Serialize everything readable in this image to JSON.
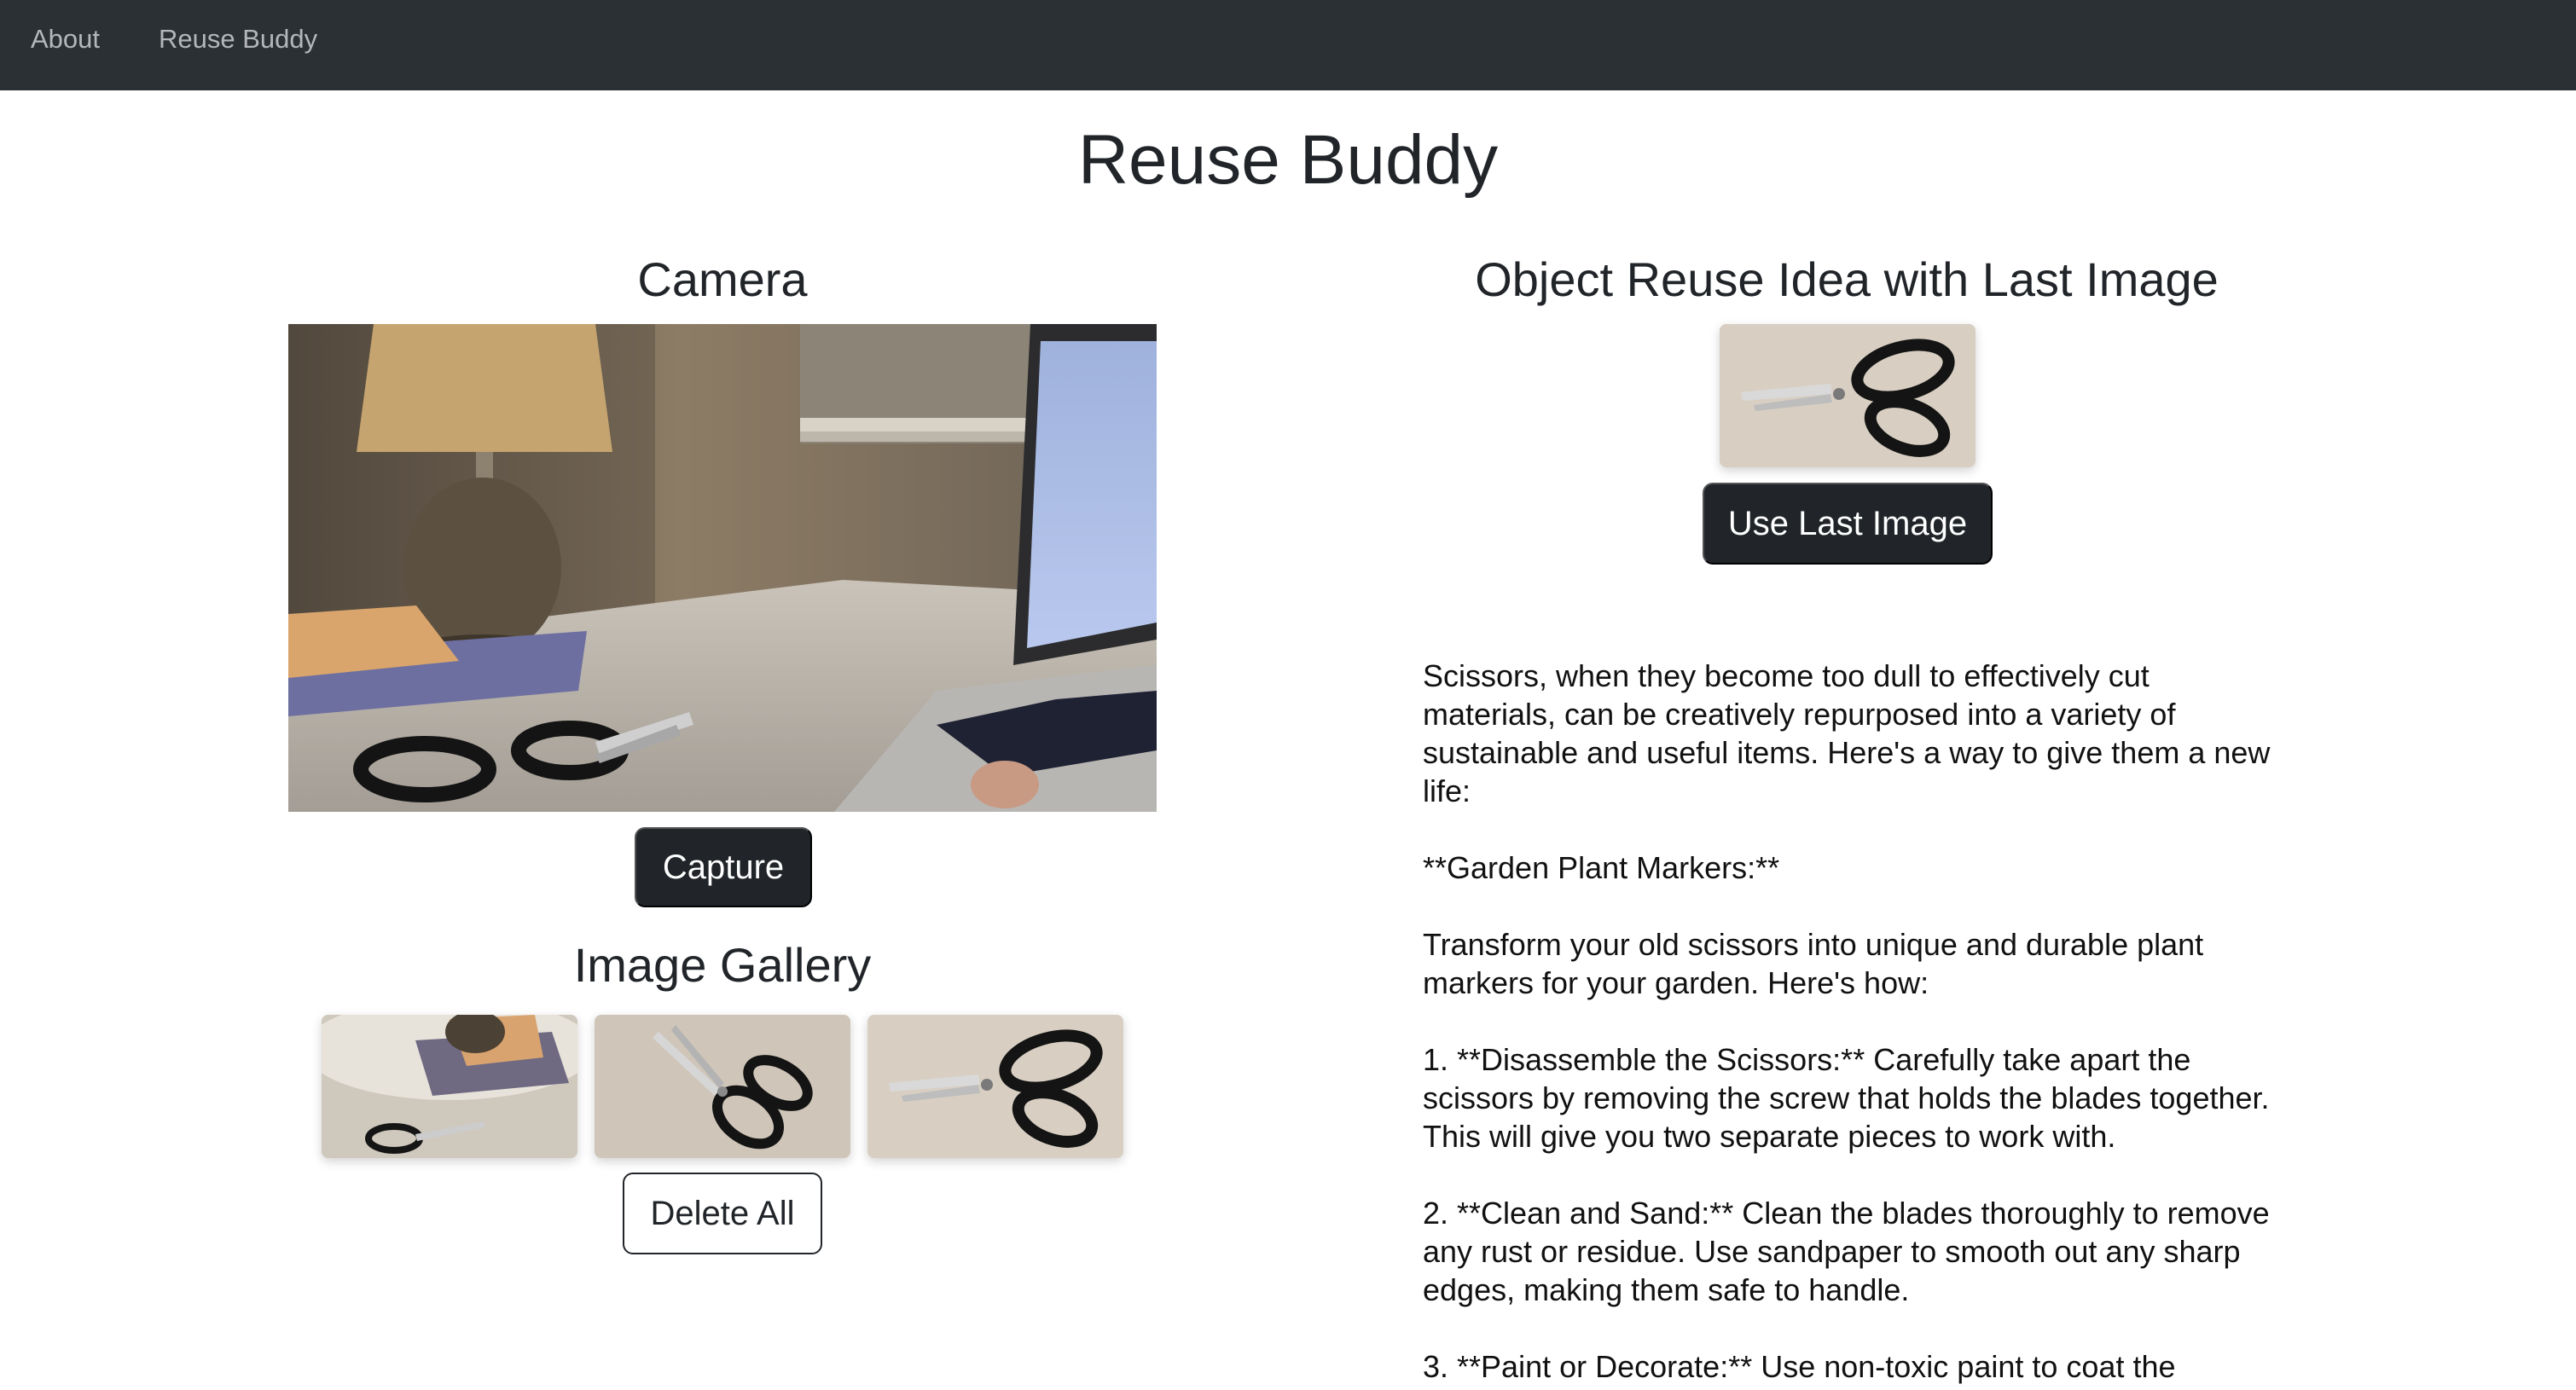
{
  "nav": {
    "about_label": "About",
    "brand_label": "Reuse Buddy"
  },
  "page": {
    "title": "Reuse Buddy"
  },
  "camera": {
    "title": "Camera",
    "capture_label": "Capture"
  },
  "gallery": {
    "title": "Image Gallery",
    "images": [
      "desk-scene-photo",
      "scissors-photo",
      "scissors-photo"
    ],
    "delete_all_label": "Delete All"
  },
  "reuse_idea": {
    "title": "Object Reuse Idea with Last Image",
    "last_image": "scissors-photo",
    "use_last_image_label": "Use Last Image",
    "paragraphs": [
      "Scissors, when they become too dull to effectively cut materials, can be creatively repurposed into a variety of sustainable and useful items. Here's a way to give them a new life:",
      "**Garden Plant Markers:**",
      "Transform your old scissors into unique and durable plant markers for your garden. Here's how:",
      "1. **Disassemble the Scissors:** Carefully take apart the scissors by removing the screw that holds the blades together. This will give you two separate pieces to work with.",
      "2. **Clean and Sand:** Clean the blades thoroughly to remove any rust or residue. Use sandpaper to smooth out any sharp edges, making them safe to handle.",
      "3. **Paint or Decorate:** Use non-toxic paint to coat the"
    ]
  },
  "colors": {
    "navbar_bg": "#2b3035",
    "nav_text": "#b4b7ba",
    "button_dark": "#212529",
    "text": "#212529"
  }
}
